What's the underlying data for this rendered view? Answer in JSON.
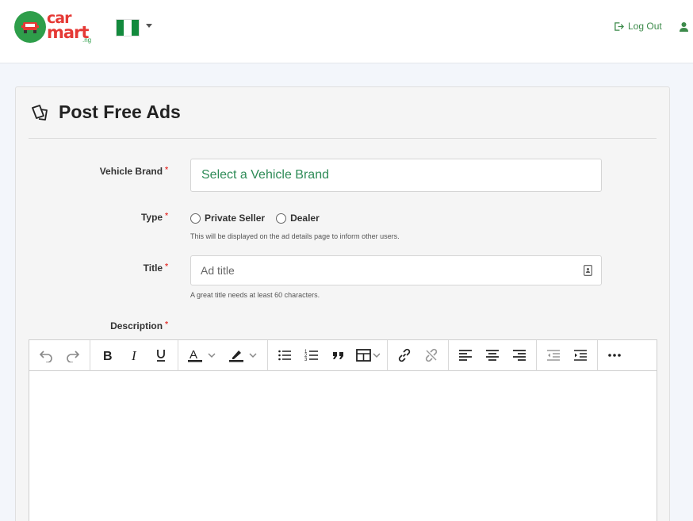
{
  "brand": {
    "name_line1": "car",
    "name_line2": "mart",
    "domain_suffix": ".ng"
  },
  "header": {
    "logout_label": "Log Out"
  },
  "page": {
    "title": "Post Free Ads"
  },
  "form": {
    "vehicle_brand": {
      "label": "Vehicle Brand",
      "required_mark": "*",
      "value": "Select a Vehicle Brand"
    },
    "type": {
      "label": "Type",
      "required_mark": "*",
      "options": [
        "Private Seller",
        "Dealer"
      ],
      "help": "This will be displayed on the ad details page to inform other users."
    },
    "title": {
      "label": "Title",
      "required_mark": "*",
      "placeholder": "Ad title",
      "help": "A great title needs at least 60 characters."
    },
    "description": {
      "label": "Description",
      "required_mark": "*"
    }
  },
  "colors": {
    "brand_green": "#2e9e4a",
    "brand_red": "#e53935",
    "link_green": "#3c8a4a",
    "select_text": "#2e8b57"
  }
}
